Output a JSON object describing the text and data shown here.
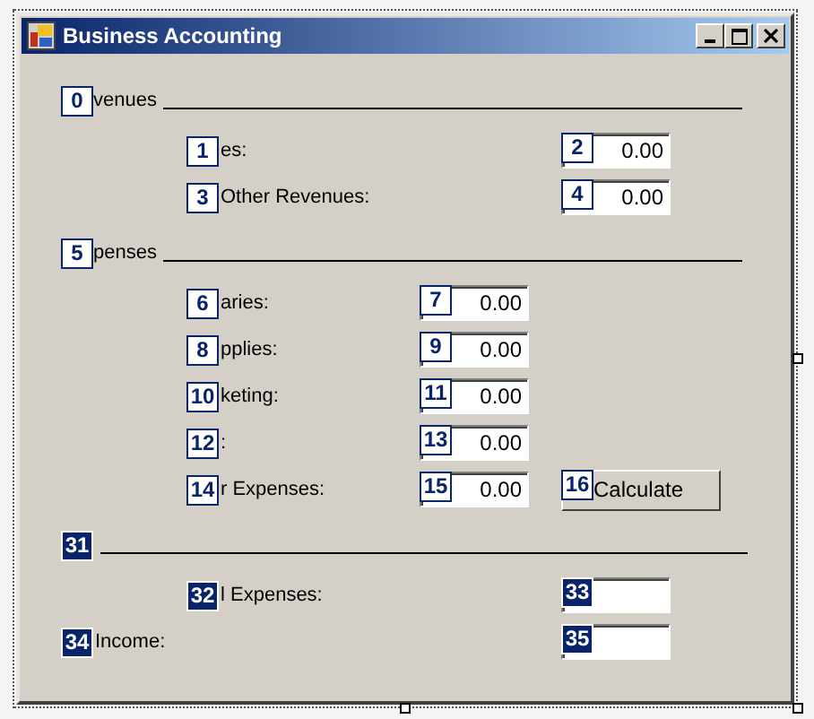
{
  "window": {
    "title": "Business Accounting"
  },
  "sections": [
    {
      "kind": "revenues",
      "header": {
        "badge": {
          "text": "0",
          "selected": false
        },
        "label": "venues"
      },
      "rows": [
        {
          "kind": "indented",
          "badge": {
            "text": "1",
            "selected": false
          },
          "label": "es:",
          "field": {
            "badge": {
              "text": "2",
              "selected": false
            },
            "value": "0.00"
          }
        },
        {
          "kind": "indented",
          "badge": {
            "text": "3",
            "selected": false
          },
          "label": "Other Revenues:",
          "field": {
            "badge": {
              "text": "4",
              "selected": false
            },
            "value": "0.00"
          }
        }
      ]
    },
    {
      "kind": "expenses",
      "header": {
        "badge": {
          "text": "5",
          "selected": false
        },
        "label": "penses"
      },
      "rows": [
        {
          "kind": "indented",
          "badge": {
            "text": "6",
            "selected": false
          },
          "label": "aries:",
          "field": {
            "badge": {
              "text": "7",
              "selected": false
            },
            "value": "0.00"
          }
        },
        {
          "kind": "indented",
          "badge": {
            "text": "8",
            "selected": false
          },
          "label": "pplies:",
          "field": {
            "badge": {
              "text": "9",
              "selected": false
            },
            "value": "0.00"
          }
        },
        {
          "kind": "indented",
          "badge": {
            "text": "10",
            "selected": false
          },
          "label": "keting:",
          "field": {
            "badge": {
              "text": "11",
              "selected": false
            },
            "value": "0.00"
          }
        },
        {
          "kind": "indented",
          "badge": {
            "text": "12",
            "selected": false
          },
          "label": ":",
          "field": {
            "badge": {
              "text": "13",
              "selected": false
            },
            "value": "0.00"
          }
        },
        {
          "kind": "indented",
          "badge": {
            "text": "14",
            "selected": false
          },
          "label": "r Expenses:",
          "field": {
            "badge": {
              "text": "15",
              "selected": false
            },
            "value": "0.00"
          },
          "button": {
            "badge": {
              "text": "16",
              "selected": false
            },
            "label": "Calculate"
          }
        }
      ]
    },
    {
      "kind": "totals",
      "header": {
        "badge": {
          "text": "31",
          "selected": true
        }
      },
      "rows": [
        {
          "kind": "indented",
          "badge": {
            "text": "32",
            "selected": true
          },
          "label": "l Expenses:",
          "field": {
            "badge": {
              "text": "33",
              "selected": true
            }
          }
        },
        {
          "kind": "flush",
          "badge": {
            "text": "34",
            "selected": true
          },
          "label": "Income:",
          "field": {
            "badge": {
              "text": "35",
              "selected": true
            }
          }
        }
      ]
    }
  ]
}
